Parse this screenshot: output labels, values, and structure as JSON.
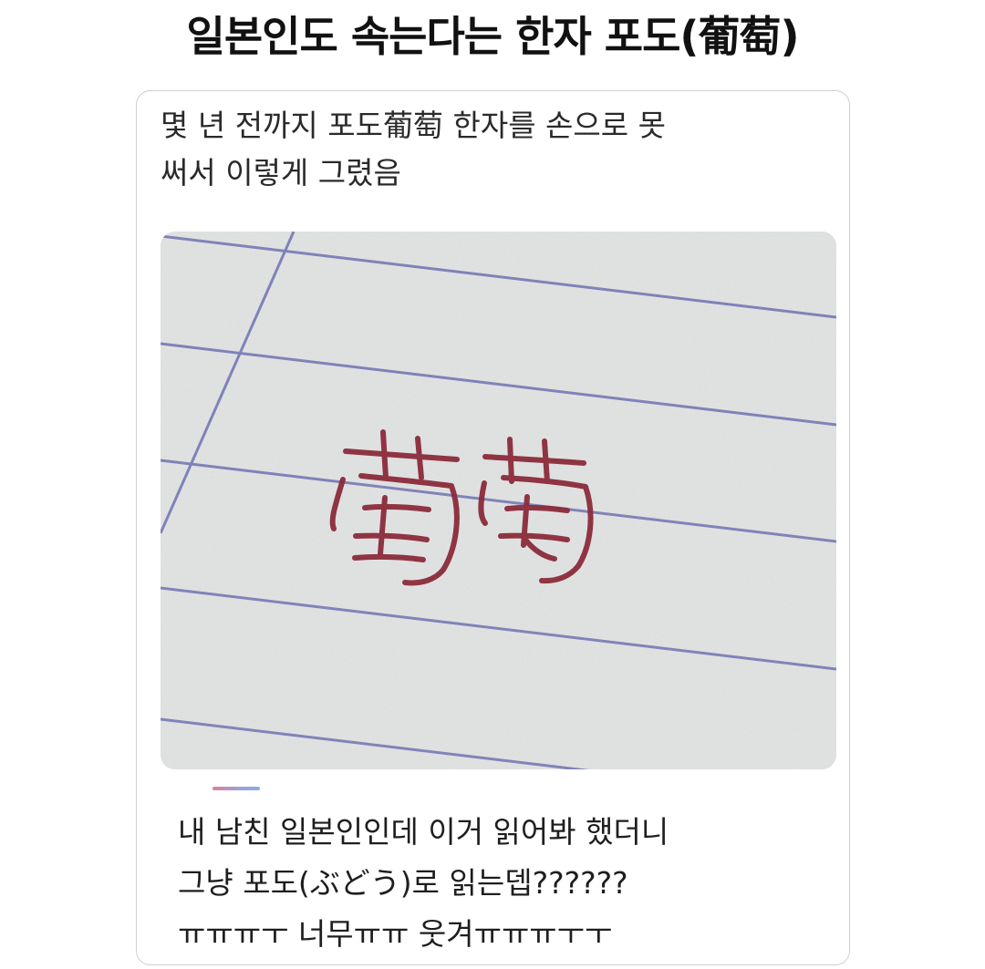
{
  "header": {
    "title": "일본인도 속는다는 한자  포도(葡萄)"
  },
  "post": {
    "top_text": "몇 년 전까지 포도葡萄 한자를 손으로 못\n써서 이렇게 그렸음",
    "image_handwriting": "葡萄",
    "reply_text": "내 남친 일본인인데 이거 읽어봐 했더니\n그냥 포도(ぶどう)로 읽는뎁??????\nㅠㅠㅠㅜ 너무ㅠㅠ 웃겨ㅠㅠㅠㅜㅜ"
  },
  "colors": {
    "ruled_line": "#5b5fa8",
    "ink": "#8b2b3a",
    "paper": "#e1e3e3"
  }
}
